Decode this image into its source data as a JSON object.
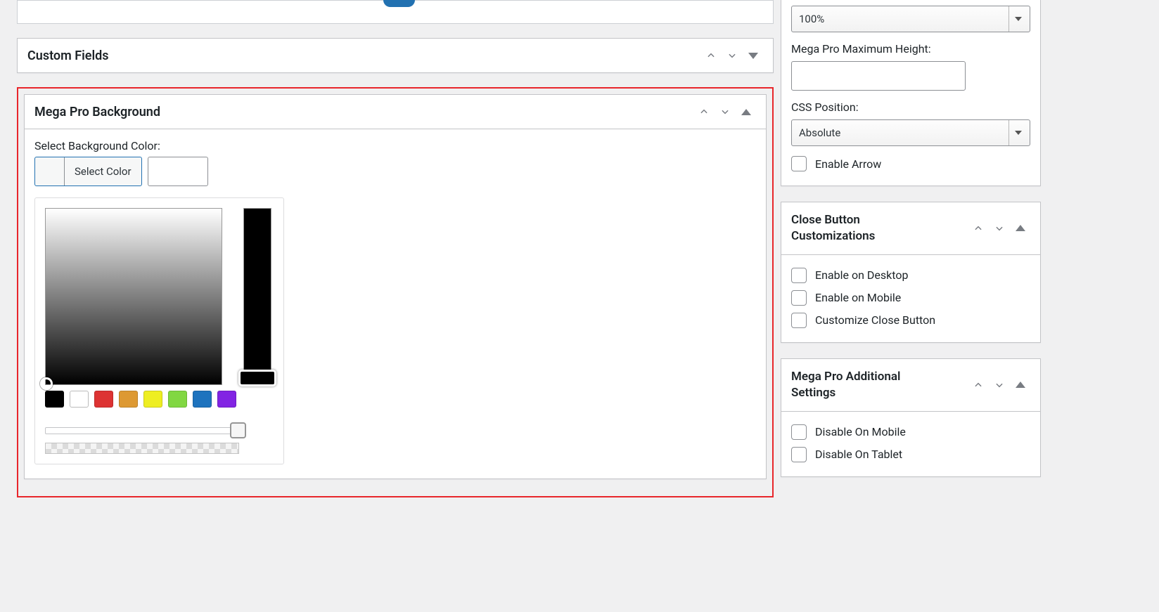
{
  "panels": {
    "custom_fields": {
      "title": "Custom Fields"
    },
    "mega_bg": {
      "title": "Mega Pro Background",
      "select_bg_label": "Select Background Color:",
      "select_color_btn": "Select Color",
      "swatches": [
        "#000000",
        "#ffffff",
        "#dd3333",
        "#dd9933",
        "#eeee22",
        "#81d742",
        "#1e73be",
        "#8224e3"
      ]
    }
  },
  "sidebar": {
    "width_select": {
      "value": "100%"
    },
    "max_height": {
      "label": "Mega Pro Maximum Height:",
      "value": ""
    },
    "css_position": {
      "label": "CSS Position:",
      "value": "Absolute"
    },
    "enable_arrow": {
      "label": "Enable Arrow"
    },
    "close_btn_panel": {
      "title": "Close Button Customizations",
      "desktop": "Enable on Desktop",
      "mobile": "Enable on Mobile",
      "customize": "Customize Close Button"
    },
    "additional_panel": {
      "title": "Mega Pro Additional Settings",
      "disable_mobile": "Disable On Mobile",
      "disable_tablet": "Disable On Tablet"
    }
  }
}
